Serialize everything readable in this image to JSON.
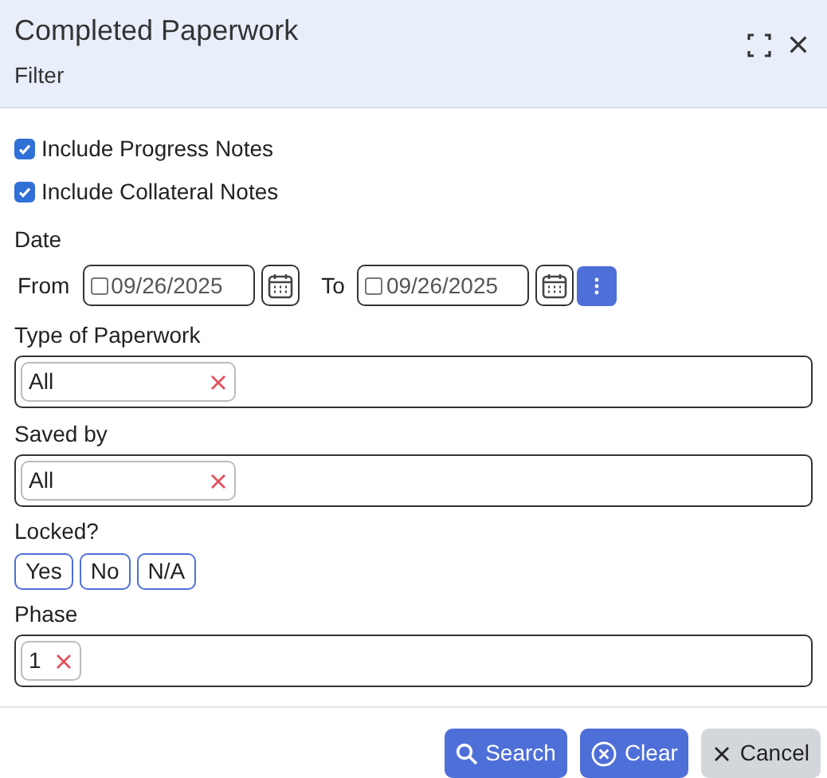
{
  "header": {
    "title": "Completed Paperwork",
    "subtitle": "Filter"
  },
  "options": [
    {
      "label": "Include Progress Notes",
      "checked": true
    },
    {
      "label": "Include Collateral Notes",
      "checked": true
    }
  ],
  "date": {
    "label": "Date",
    "from": {
      "label": "From",
      "value": "09/26/2025",
      "checked": false
    },
    "to": {
      "label": "To",
      "value": "09/26/2025",
      "checked": false
    }
  },
  "type_of_paperwork": {
    "label": "Type of Paperwork",
    "tags": [
      "All"
    ]
  },
  "saved_by": {
    "label": "Saved by",
    "tags": [
      "All"
    ]
  },
  "locked": {
    "label": "Locked?",
    "choices": [
      {
        "label": "Yes",
        "selected": false
      },
      {
        "label": "No",
        "selected": false
      },
      {
        "label": "N/A",
        "selected": false
      }
    ]
  },
  "phase": {
    "label": "Phase",
    "tags": [
      "1"
    ]
  },
  "buttons": [
    {
      "kind": "search",
      "label": "Search"
    },
    {
      "kind": "clear",
      "label": "Clear"
    },
    {
      "kind": "cancel",
      "label": "Cancel"
    }
  ]
}
